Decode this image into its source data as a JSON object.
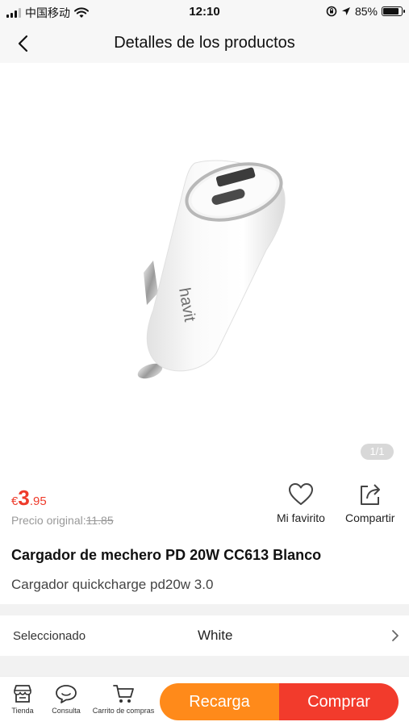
{
  "status_bar": {
    "carrier": "中国移动",
    "time": "12:10",
    "battery_percent": "85%",
    "battery_level": 0.85,
    "icons": [
      "signal-icon",
      "wifi-icon",
      "rotation-lock-icon",
      "location-icon",
      "battery-icon"
    ]
  },
  "header": {
    "title": "Detalles de los productos",
    "back_icon": "chevron-left-icon"
  },
  "gallery": {
    "counter": "1/1",
    "product_brand_text": "havit"
  },
  "price": {
    "currency": "€",
    "integer": "3",
    "decimal": ".95",
    "original_label": "Precio original:",
    "original_value": "11.85"
  },
  "actions": {
    "favorite_label": "Mi favirito",
    "share_label": "Compartir"
  },
  "product": {
    "title": "Cargador de mechero PD 20W CC613 Blanco",
    "subtitle": "Cargador quickcharge pd20w 3.0"
  },
  "selection": {
    "label": "Seleccionado",
    "value": "White"
  },
  "bottom_bar": {
    "tabs": [
      {
        "label": "Tienda",
        "icon": "store-icon"
      },
      {
        "label": "Consulta",
        "icon": "chat-icon"
      },
      {
        "label": "Carrito de compras",
        "icon": "cart-icon"
      }
    ],
    "recarga_label": "Recarga",
    "comprar_label": "Comprar"
  },
  "colors": {
    "price_red": "#ee3b2b",
    "recarga_orange": "#ff8a1a",
    "comprar_red": "#f23b2c"
  }
}
